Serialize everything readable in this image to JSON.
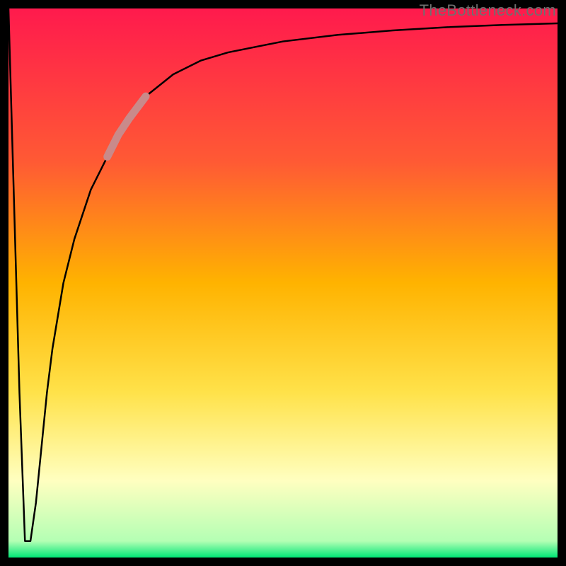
{
  "attribution": "TheBottleneck.com",
  "colors": {
    "frame": "#000000",
    "gradient_top": "#ff1a4d",
    "gradient_mid_upper": "#ff5a34",
    "gradient_mid": "#ffb300",
    "gradient_mid_lower": "#ffe24a",
    "gradient_light": "#ffffc0",
    "gradient_bottom": "#00e676",
    "curve": "#000000",
    "highlight": "#c98a8a"
  },
  "chart_data": {
    "type": "line",
    "title": "",
    "xlabel": "",
    "ylabel": "",
    "xlim": [
      0,
      100
    ],
    "ylim": [
      0,
      100
    ],
    "grid": false,
    "annotations": [],
    "series": [
      {
        "name": "curve",
        "x": [
          0,
          2,
          3,
          4,
          5,
          6,
          7,
          8,
          10,
          12,
          15,
          18,
          20,
          22,
          25,
          30,
          35,
          40,
          50,
          60,
          70,
          80,
          90,
          100
        ],
        "y": [
          100,
          30,
          3,
          3,
          10,
          20,
          30,
          38,
          50,
          58,
          67,
          73,
          77,
          80,
          84,
          88,
          90.5,
          92,
          94,
          95.2,
          96,
          96.6,
          97,
          97.3
        ]
      }
    ],
    "highlight_segment": {
      "x_start": 18,
      "x_end": 25
    }
  }
}
